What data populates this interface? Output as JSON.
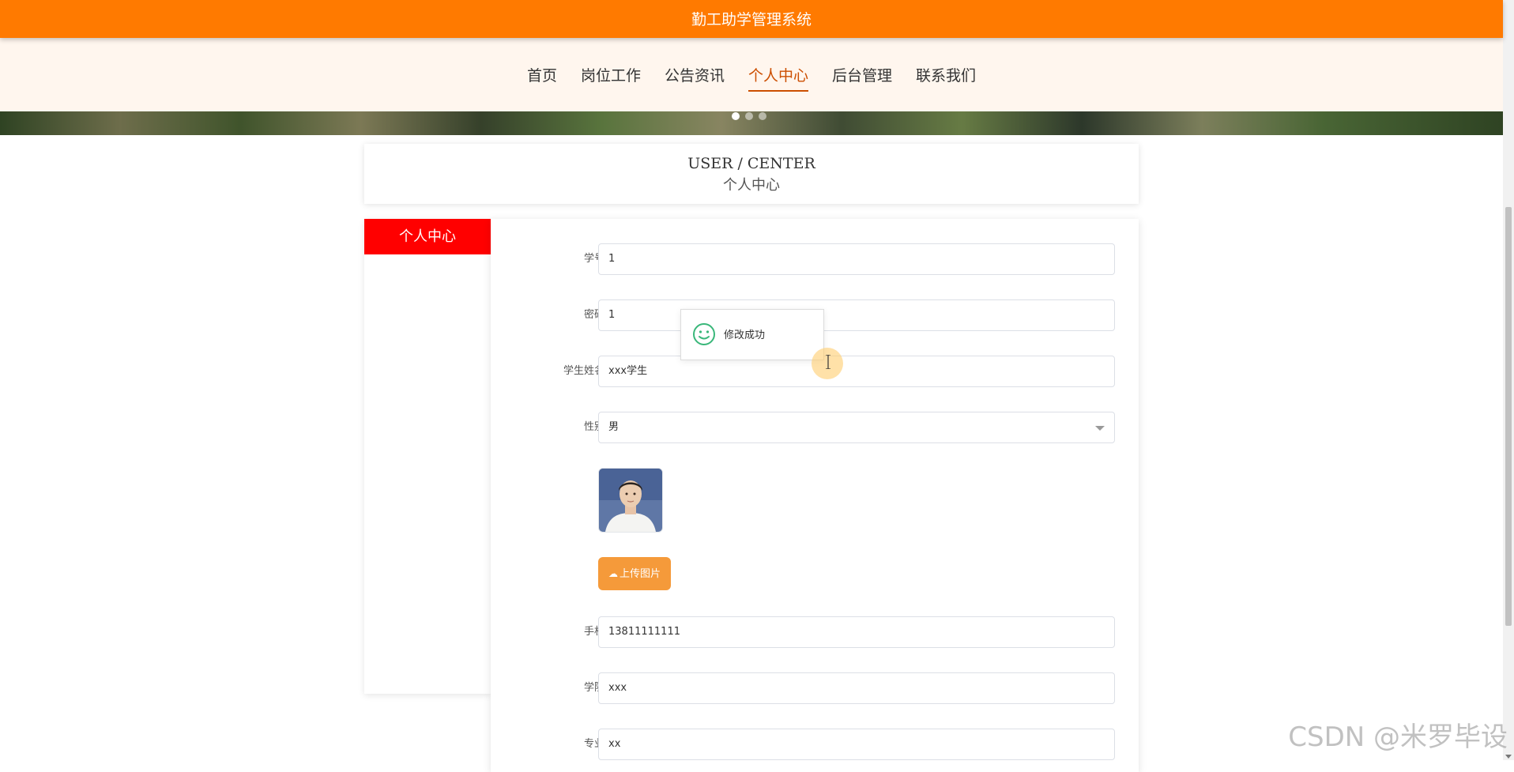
{
  "site": {
    "title": "勤工助学管理系统"
  },
  "nav": {
    "items": [
      {
        "label": "首页"
      },
      {
        "label": "岗位工作"
      },
      {
        "label": "公告资讯"
      },
      {
        "label": "个人中心"
      },
      {
        "label": "后台管理"
      },
      {
        "label": "联系我们"
      }
    ],
    "active_label": "个人中心"
  },
  "banner": {
    "dot_count": 3,
    "active_dot": 1
  },
  "page_header": {
    "english": "USER / CENTER",
    "chinese": "个人中心"
  },
  "side_menu": {
    "active_item": "个人中心"
  },
  "form": {
    "student_id": {
      "label": "学号",
      "value": "1"
    },
    "password": {
      "label": "密码",
      "value": "1"
    },
    "student_name": {
      "label": "学生姓名",
      "value": "xxx学生"
    },
    "gender": {
      "label": "性别",
      "value": "男"
    },
    "upload_button": "上传图片",
    "phone": {
      "label": "手机",
      "value": "13811111111"
    },
    "college": {
      "label": "学院",
      "value": "xxx"
    },
    "major": {
      "label": "专业",
      "value": "xx"
    }
  },
  "toast": {
    "message": "修改成功",
    "icon": "smile-icon"
  },
  "watermark": "CSDN @米罗毕设",
  "colors": {
    "topbar": "#ff7a00",
    "nav_bg": "#fff6ee",
    "nav_active": "#cc4e00",
    "side_active": "#ff0000",
    "upload_button": "#f59a3a",
    "toast_icon": "#3ab77a"
  }
}
